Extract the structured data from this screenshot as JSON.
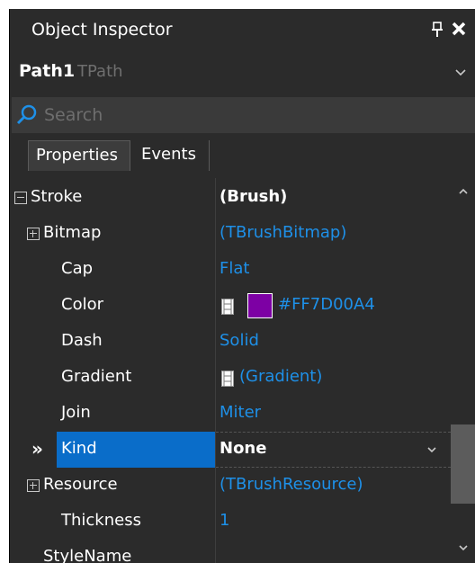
{
  "panel": {
    "title": "Object Inspector",
    "pin_icon": "pin-icon",
    "close_icon": "close-icon"
  },
  "object": {
    "name": "Path1",
    "type": "TPath"
  },
  "search": {
    "placeholder": "Search",
    "value": ""
  },
  "tabs": [
    {
      "label": "Properties",
      "active": true
    },
    {
      "label": "Events",
      "active": false
    }
  ],
  "properties": [
    {
      "name": "Stroke",
      "value": "(Brush)",
      "expander": "minus",
      "bold_value": true
    },
    {
      "name": "Bitmap",
      "value": "(TBrushBitmap)",
      "expander": "plus"
    },
    {
      "name": "Cap",
      "value": "Flat"
    },
    {
      "name": "Color",
      "value": "#FF7D00A4",
      "swatch": "#7d00a4"
    },
    {
      "name": "Dash",
      "value": "Solid"
    },
    {
      "name": "Gradient",
      "value": "(Gradient)"
    },
    {
      "name": "Join",
      "value": "Miter"
    },
    {
      "name": "Kind",
      "value": "None",
      "selected": true,
      "bold_value": true,
      "marker": "»"
    },
    {
      "name": "Resource",
      "value": "(TBrushResource)",
      "expander": "plus"
    },
    {
      "name": "Thickness",
      "value": "1"
    },
    {
      "name": "StyleName",
      "value": ""
    }
  ],
  "colors": {
    "background": "#2b2b2b",
    "value_text": "#1e90e8",
    "selection": "#0a6dc9",
    "swatch": "#7d00a4"
  }
}
